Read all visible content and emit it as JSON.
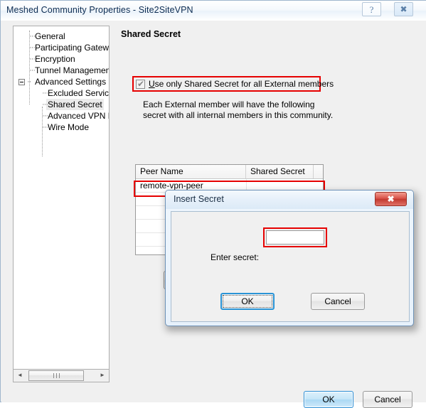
{
  "window": {
    "title": "Meshed Community Properties - Site2SiteVPN",
    "help_glyph": "?",
    "close_glyph": "✖"
  },
  "tree": {
    "items": [
      {
        "label": "General",
        "level": 1,
        "selected": false
      },
      {
        "label": "Participating Gateways",
        "level": 1,
        "selected": false
      },
      {
        "label": "Encryption",
        "level": 1,
        "selected": false
      },
      {
        "label": "Tunnel Management",
        "level": 1,
        "selected": false
      },
      {
        "label": "Advanced Settings",
        "level": 1,
        "selected": false,
        "expander": "collapse"
      },
      {
        "label": "Excluded Services",
        "level": 2,
        "selected": false
      },
      {
        "label": "Shared Secret",
        "level": 2,
        "selected": true
      },
      {
        "label": "Advanced VPN Pro",
        "level": 2,
        "selected": false
      },
      {
        "label": "Wire Mode",
        "level": 2,
        "selected": false
      }
    ]
  },
  "scrollbar": {
    "left_arrow": "◄",
    "right_arrow": "►"
  },
  "page": {
    "heading": "Shared Secret",
    "checkbox_label_prefix": "U",
    "checkbox_label_rest": "se only Shared Secret for all External members",
    "checkbox_checked": true,
    "check_glyph": "✔",
    "description": "Each External member will have the following\nsecret with all internal members in this community.",
    "highlight_color": "#e60000"
  },
  "table": {
    "columns": [
      "Peer Name",
      "Shared Secret"
    ],
    "rows": [
      {
        "peer_name": "remote-vpn-peer",
        "shared_secret": "",
        "highlighted": true
      },
      {
        "peer_name": "",
        "shared_secret": "",
        "highlighted": false
      },
      {
        "peer_name": "",
        "shared_secret": "",
        "highlighted": false
      },
      {
        "peer_name": "",
        "shared_secret": "",
        "highlighted": false
      },
      {
        "peer_name": "",
        "shared_secret": "",
        "highlighted": false
      },
      {
        "peer_name": "",
        "shared_secret": "",
        "highlighted": false
      }
    ]
  },
  "footer": {
    "ok_label": "OK",
    "cancel_label": "Cancel"
  },
  "modal": {
    "title": "Insert Secret",
    "close_glyph": "✖",
    "field_label": "Enter secret:",
    "field_value": "",
    "field_placeholder": "",
    "ok_label": "OK",
    "cancel_label": "Cancel"
  }
}
